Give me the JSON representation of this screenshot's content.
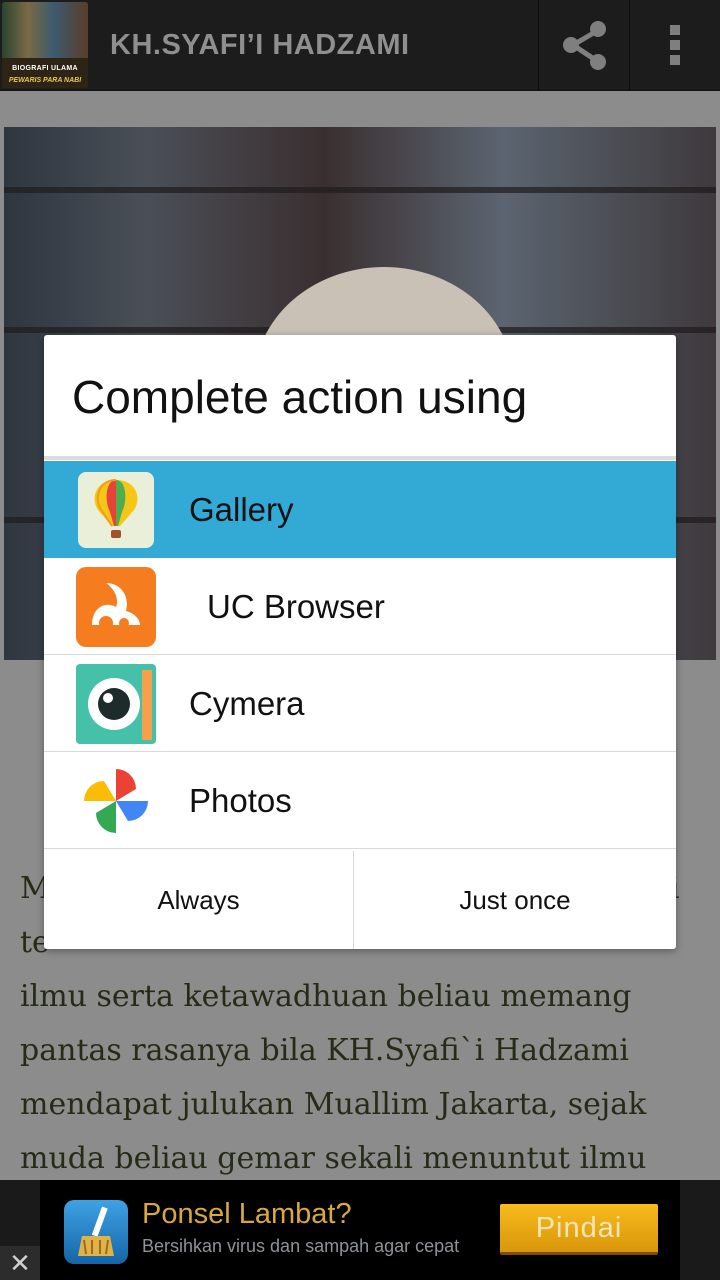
{
  "actionbar": {
    "title": "KH.SYAFI’I HADZAMI",
    "logo_line1": "BIOGRAFI ULAMA",
    "logo_line2": "PEWARIS PARA NABI",
    "share_icon": "share-icon",
    "menu_icon": "overflow-menu-icon"
  },
  "article": {
    "line1": "M",
    "line1_end": "i",
    "line2": "te",
    "lines": [
      "ilmu serta ketawadhuan beliau memang",
      "pantas rasanya bila KH.Syafi`i Hadzami",
      "mendapat julukan Muallim Jakarta, sejak",
      "muda beliau gemar sekali menuntut ilmu"
    ]
  },
  "dialog": {
    "title": "Complete action using",
    "options": [
      {
        "label": "Gallery",
        "icon": "gallery-balloon-icon",
        "selected": true
      },
      {
        "label": "UC Browser",
        "icon": "uc-browser-squirrel-icon",
        "selected": false
      },
      {
        "label": "Cymera",
        "icon": "cymera-camera-icon",
        "selected": false
      },
      {
        "label": "Photos",
        "icon": "google-photos-pinwheel-icon",
        "selected": false
      }
    ],
    "buttons": {
      "always": "Always",
      "just_once": "Just once"
    },
    "colors": {
      "selected": "#33a9d6"
    }
  },
  "ad": {
    "headline": "Ponsel Lambat?",
    "subtext": "Bersihkan virus dan sampah agar cepat",
    "cta": "Pindai",
    "close": "✕",
    "icon": "broom-cleaner-icon"
  }
}
